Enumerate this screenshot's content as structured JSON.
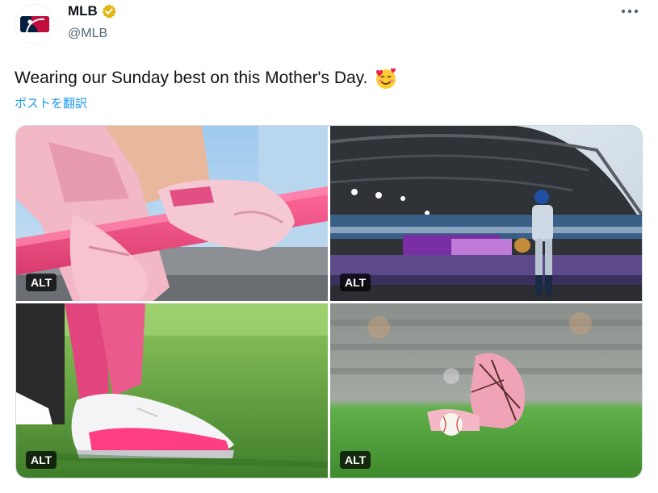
{
  "account": {
    "display_name": "MLB",
    "handle": "@MLB",
    "verified_icon": "verified-badge-icon",
    "brand_colors": {
      "blue": "#041e42",
      "red": "#bf0d3e"
    }
  },
  "tweet": {
    "text": "Wearing our Sunday best on this Mother's Day.",
    "emoji": "smiling-face-with-hearts",
    "translate_link": "ポストを翻訳"
  },
  "media": {
    "photos": [
      {
        "subject": "pink-batting-gloves-bat",
        "alt_label": "ALT"
      },
      {
        "subject": "player-in-stadium",
        "alt_label": "ALT"
      },
      {
        "subject": "pink-cleats-on-grass",
        "alt_label": "ALT"
      },
      {
        "subject": "pink-glove-and-ball-on-grass",
        "alt_label": "ALT"
      }
    ]
  },
  "colors": {
    "link": "#1d9bf0",
    "secondary_text": "#536471",
    "text": "#0f1419"
  }
}
